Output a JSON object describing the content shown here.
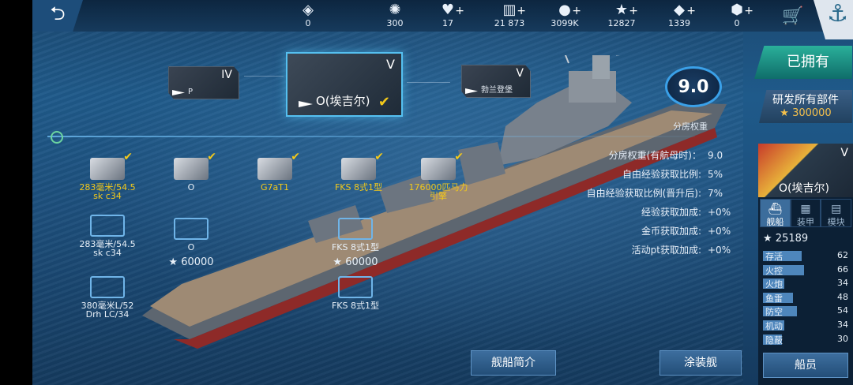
{
  "topbar": {
    "back_label": "⮌",
    "resources": [
      {
        "icon": "rank-badge-icon",
        "glyph": "◈",
        "value": "0",
        "plus": false
      },
      {
        "icon": "compass-icon",
        "glyph": "✺",
        "value": "300",
        "plus": false
      },
      {
        "icon": "heart-icon",
        "glyph": "♥",
        "value": "17",
        "plus": true
      },
      {
        "icon": "card-icon",
        "glyph": "▥",
        "value": "21 873",
        "plus": true
      },
      {
        "icon": "gold-coin-icon",
        "glyph": "●",
        "value": "3099K",
        "plus": true
      },
      {
        "icon": "star-icon",
        "glyph": "★",
        "value": "12827",
        "plus": true
      },
      {
        "icon": "diamond-icon",
        "glyph": "◆",
        "value": "1339",
        "plus": true
      },
      {
        "icon": "cube-icon",
        "glyph": "⬢",
        "value": "0",
        "plus": true
      }
    ]
  },
  "tree": {
    "prev": {
      "tier": "IV",
      "name": "P"
    },
    "current": {
      "tier": "V",
      "name": "O(埃吉尔)"
    },
    "next": {
      "tier": "V",
      "name": "勃兰登堡"
    }
  },
  "weight": {
    "value": "9.0",
    "label": "分房权重"
  },
  "stats": [
    {
      "label": "分房权重(有航母时)：",
      "value": "9.0"
    },
    {
      "label": "自由经验获取比例:",
      "value": "5%"
    },
    {
      "label": "自由经验获取比例(晋升后):",
      "value": "7%"
    },
    {
      "label": "经验获取加成:",
      "value": "+0%"
    },
    {
      "label": "金币获取加成:",
      "value": "+0%"
    },
    {
      "label": "活动pt获取加成:",
      "value": "+0%"
    }
  ],
  "owned_label": "已拥有",
  "research": {
    "label": "研发所有部件",
    "cost": "★ 300000"
  },
  "panel": {
    "tier": "V",
    "name": "O(埃吉尔)",
    "tabs": [
      "舰船",
      "装甲",
      "模块"
    ],
    "exp": "25189",
    "props": [
      {
        "label": "存活",
        "value": "62",
        "fill": 0.62
      },
      {
        "label": "火控",
        "value": "66",
        "fill": 0.66
      },
      {
        "label": "火炮",
        "value": "34",
        "fill": 0.34
      },
      {
        "label": "鱼雷",
        "value": "48",
        "fill": 0.48
      },
      {
        "label": "防空",
        "value": "54",
        "fill": 0.54
      },
      {
        "label": "机动",
        "value": "34",
        "fill": 0.34
      },
      {
        "label": "隐蔽",
        "value": "30",
        "fill": 0.3
      }
    ],
    "crew_label": "船员"
  },
  "modules": {
    "installed": [
      {
        "label": "283毫米/54.5\nsk c34"
      },
      {
        "label": "O"
      },
      {
        "label": "G7aT1"
      },
      {
        "label": "FKS 8式1型"
      },
      {
        "label": "176000匹马力\n引擎"
      }
    ],
    "upgrades": [
      {
        "label": "283毫米/54.5\nsk c34"
      },
      {
        "label": "O",
        "cost": "60000"
      },
      {
        "label": "FKS 8式1型",
        "cost": "60000"
      },
      {
        "label": "380毫米L/52\nDrh LC/34"
      },
      {
        "label": "FKS 8式1型"
      }
    ]
  },
  "buttons": {
    "intro": "舰船简介",
    "paint": "涂装舰"
  },
  "colors": {
    "accent": "#f2c81a",
    "owned": "#2ab09a",
    "highlight": "#55c0f0"
  }
}
